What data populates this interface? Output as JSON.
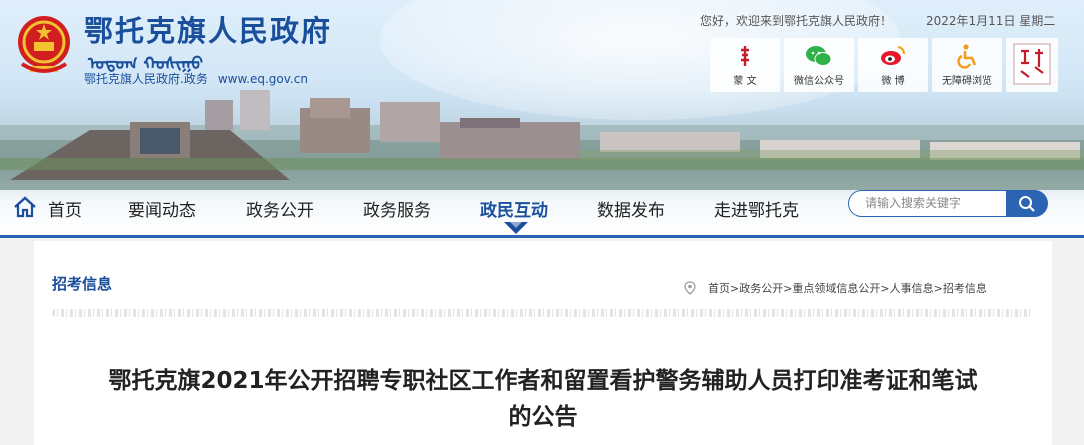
{
  "site": {
    "title": "鄂托克旗人民政府",
    "mongolian": "ᠣᠲᠣᠭ ᠬᠣᠰᠢᠭᠤ",
    "domain_name": "鄂托克旗人民政府.政务",
    "domain_url": "www.eq.gov.cn"
  },
  "topbar": {
    "welcome": "您好，欢迎来到鄂托克旗人民政府！",
    "date": "2022年1月11日 星期二"
  },
  "tools": [
    {
      "label": "蒙 文",
      "icon": "mongolian-script-icon"
    },
    {
      "label": "微信公众号",
      "icon": "wechat-icon"
    },
    {
      "label": "微 博",
      "icon": "weibo-icon"
    },
    {
      "label": "无障碍浏览",
      "icon": "accessibility-icon"
    },
    {
      "label": "",
      "icon": "seal-logo-icon"
    }
  ],
  "nav": {
    "items": [
      {
        "label": "首页"
      },
      {
        "label": "要闻动态"
      },
      {
        "label": "政务公开"
      },
      {
        "label": "政务服务"
      },
      {
        "label": "政民互动"
      },
      {
        "label": "数据发布"
      },
      {
        "label": "走进鄂托克"
      }
    ],
    "active_index": 4
  },
  "search": {
    "placeholder": "请输入搜索关键字"
  },
  "content": {
    "section_title": "招考信息",
    "breadcrumb": "首页>政务公开>重点领域信息公开>人事信息>招考信息",
    "article_title_line1": "鄂托克旗2021年公开招聘专职社区工作者和留置看护警务辅助人员打印准考证和笔试",
    "article_title_line2": "的公告"
  },
  "colors": {
    "brand_blue": "#1a4f9c",
    "nav_blue": "#2a64b3"
  }
}
